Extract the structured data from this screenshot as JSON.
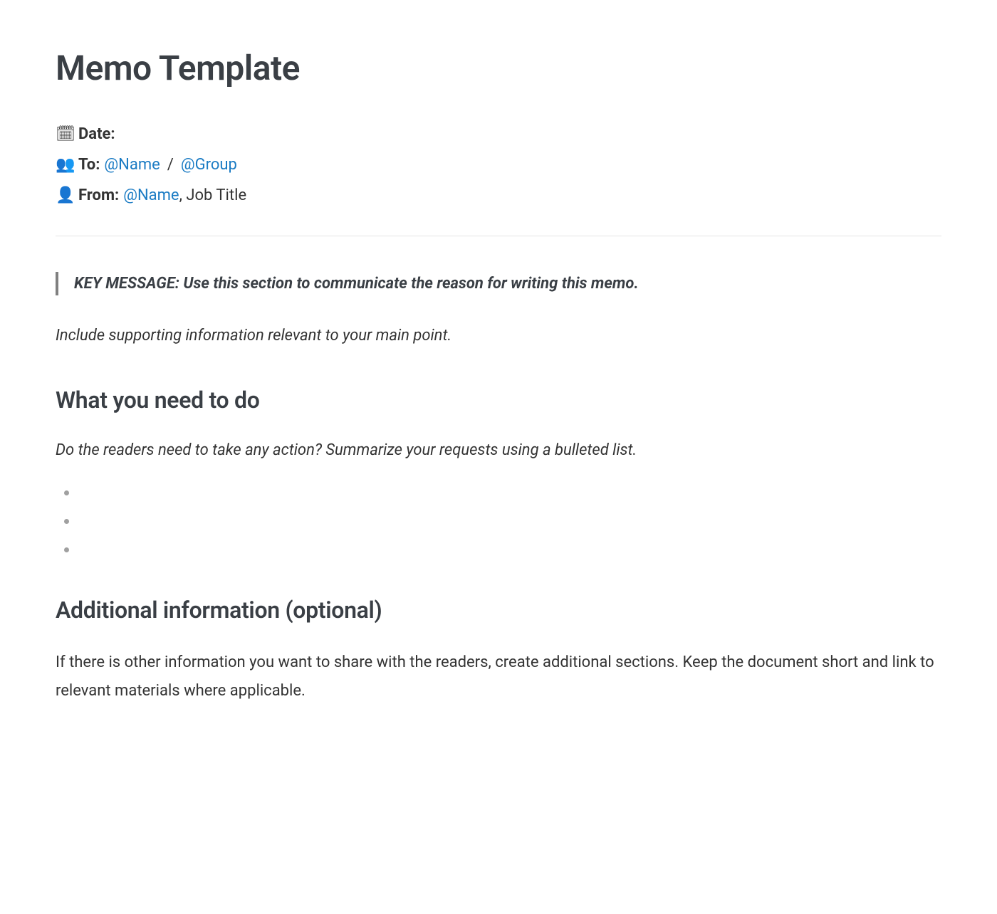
{
  "title": "Memo Template",
  "meta": {
    "date": {
      "icon": "🗓",
      "label": "Date:"
    },
    "to": {
      "icon": "👥",
      "label": "To:",
      "name_mention": "@Name",
      "separator": "/",
      "group_mention": "@Group"
    },
    "from": {
      "icon": "👤",
      "label": "From:",
      "name_mention": "@Name",
      "job_title": ", Job Title"
    }
  },
  "key_message": "KEY MESSAGE: Use this section to communicate the reason for writing this memo.",
  "supporting_text": "Include supporting information relevant to your main point.",
  "sections": {
    "todo": {
      "heading": "What you need to do",
      "description": "Do the readers need to take any action? Summarize your requests using a bulleted list.",
      "bullets": [
        "",
        "",
        ""
      ]
    },
    "additional": {
      "heading": "Additional information (optional)",
      "body": "If there is other information you want to share with the readers, create additional sections. Keep the document short and link to relevant materials where applicable."
    }
  }
}
